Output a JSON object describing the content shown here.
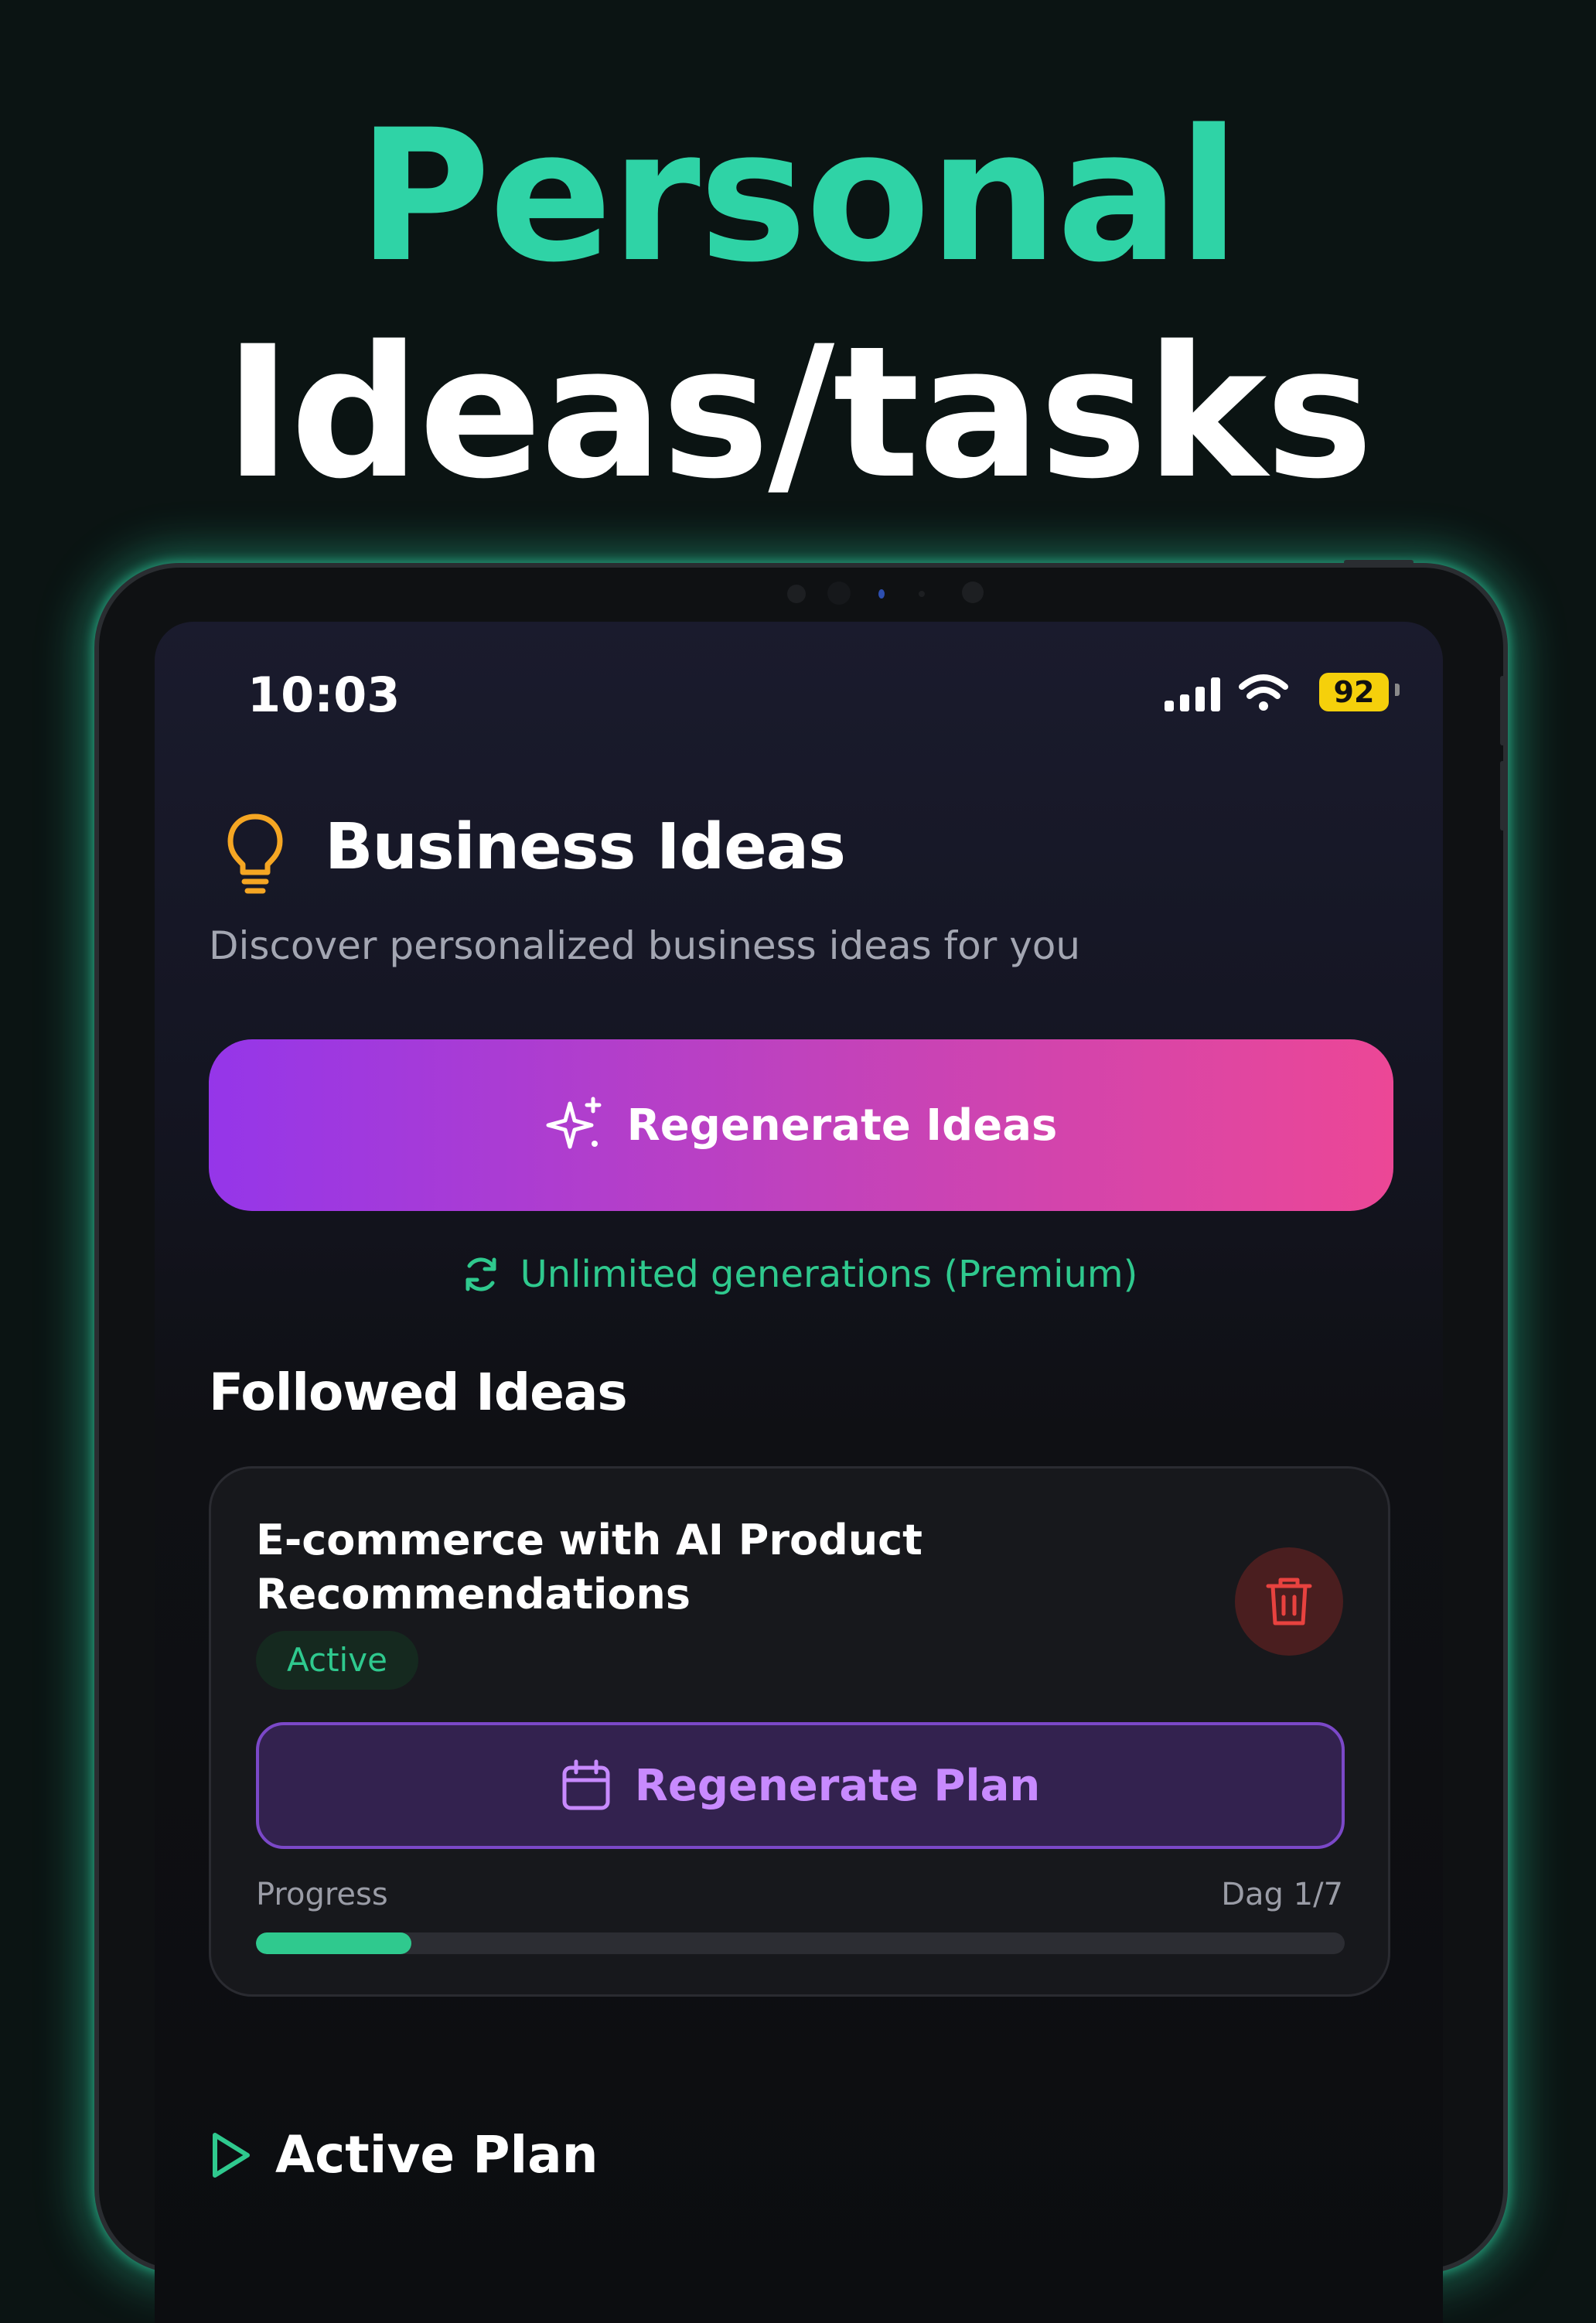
{
  "headline": {
    "line1": "Personal",
    "line2": "Ideas/tasks"
  },
  "colors": {
    "accent": "#2fd3a6",
    "gradient_start": "#9536e9",
    "gradient_end": "#ec4796"
  },
  "status_bar": {
    "time": "10:03",
    "battery": "92"
  },
  "page": {
    "title": "Business Ideas",
    "subtitle": "Discover personalized business ideas for you",
    "regenerate_button": "Regenerate Ideas",
    "unlimited_note": "Unlimited generations (Premium)"
  },
  "followed": {
    "section_title": "Followed Ideas",
    "cards": [
      {
        "title": "E-commerce with AI Product Recommendations",
        "status": "Active",
        "plan_button": "Regenerate Plan",
        "progress_label": "Progress",
        "progress_value": "Dag 1/7",
        "progress_fraction": 0.143
      }
    ]
  },
  "active_plan": {
    "title": "Active Plan"
  }
}
